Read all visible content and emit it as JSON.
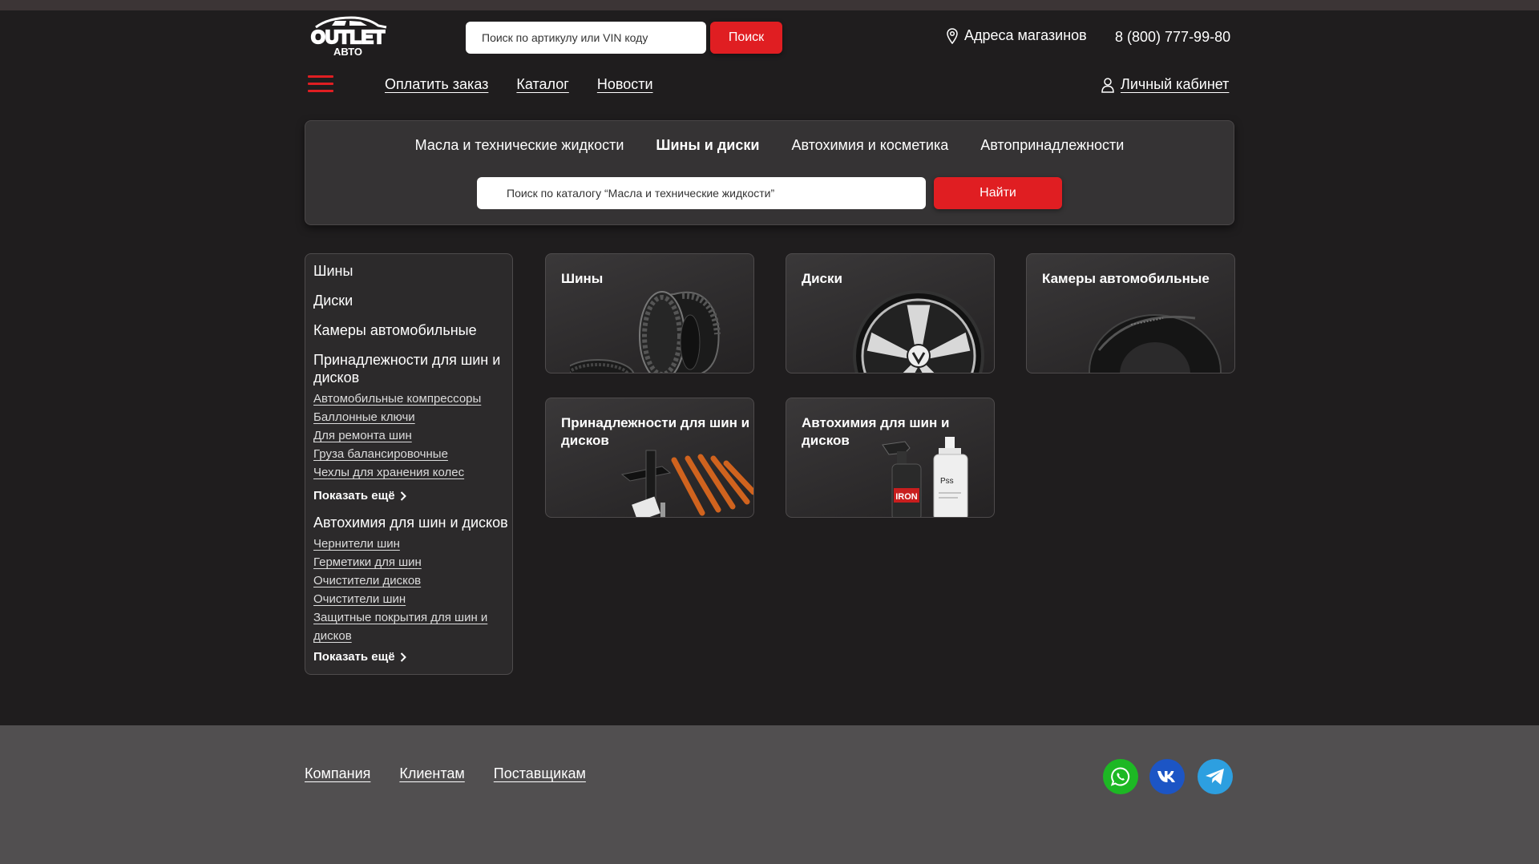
{
  "header": {
    "logo_text_top": "OUTLET",
    "logo_text_bottom": "АВТО",
    "search_placeholder": "Поиск по артикулу или VIN коду",
    "search_button": "Поиск",
    "stores_label": "Адреса магазинов",
    "phone": "8 (800) 777-99-80"
  },
  "nav": {
    "items": [
      "Оплатить заказ",
      "Каталог",
      "Новости"
    ],
    "cabinet": "Личный кабинет"
  },
  "catalog": {
    "tabs": [
      {
        "label": "Масла и технические жидкости",
        "active": false
      },
      {
        "label": "Шины и диски",
        "active": true
      },
      {
        "label": "Автохимия и косметика",
        "active": false
      },
      {
        "label": "Автопринадлежности",
        "active": false
      }
    ],
    "search_placeholder": "Поиск по каталогу “Масла и технические жидкости”",
    "search_button": "Найти"
  },
  "sidebar": {
    "head1": "Шины",
    "head2": "Диски",
    "head3": "Камеры автомобильные",
    "head4": "Принадлежности для шин и дисков",
    "group4_links": [
      "Автомобильные компрессоры",
      "Баллонные ключи",
      "Для ремонта шин",
      "Груза балансировочные",
      "Чехлы для хранения колес"
    ],
    "more": "Показать ещё",
    "head5": "Автохимия для шин и дисков",
    "group5_links": [
      "Чернители шин",
      "Герметики для шин",
      "Очистители дисков",
      "Очистители шин",
      "Защитные покрытия для шин и дисков"
    ]
  },
  "cards": [
    {
      "title": "Шины"
    },
    {
      "title": "Диски"
    },
    {
      "title": "Камеры автомобильные"
    },
    {
      "title": "Принадлежности для шин и дисков"
    },
    {
      "title": "Автохимия для шин и дисков"
    }
  ],
  "product_labels": {
    "bottle1": "IRON",
    "bottle2": "Pss"
  },
  "footer": {
    "links": [
      "Компания",
      "Клиентам",
      "Поставщикам"
    ],
    "social": [
      {
        "name": "whatsapp-icon",
        "color": "#1db824"
      },
      {
        "name": "vk-icon",
        "color": "#1c55c5"
      },
      {
        "name": "telegram-icon",
        "color": "#2d9fe0"
      }
    ]
  },
  "colors": {
    "accent": "#e01e22",
    "background": "#1f1d1e",
    "footer": "#514f50"
  }
}
